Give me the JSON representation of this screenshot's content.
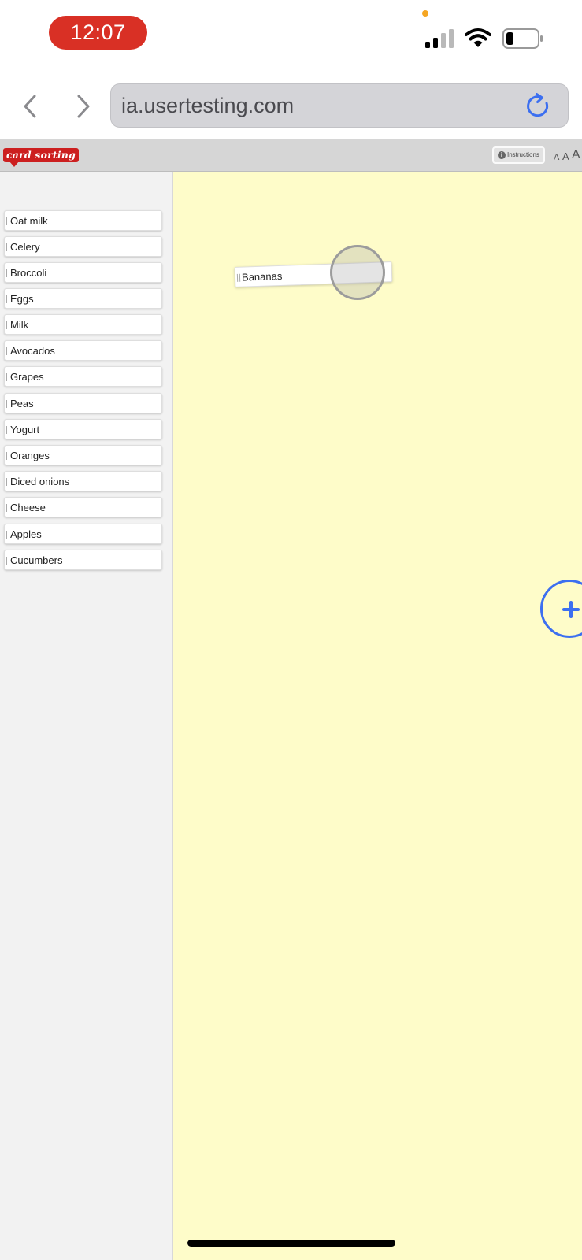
{
  "status_bar": {
    "time": "12:07"
  },
  "browser": {
    "url": "ia.usertesting.com"
  },
  "app": {
    "logo_text": "card sorting",
    "instructions_label": "Instructions",
    "font_sizes": [
      "A",
      "A",
      "A"
    ]
  },
  "sidebar": {
    "cards": [
      {
        "label": "Oat milk"
      },
      {
        "label": "Celery"
      },
      {
        "label": "Broccoli"
      },
      {
        "label": "Eggs"
      },
      {
        "label": "Milk"
      },
      {
        "label": "Avocados"
      },
      {
        "label": "Grapes"
      },
      {
        "label": "Peas"
      },
      {
        "label": "Yogurt"
      },
      {
        "label": "Oranges"
      },
      {
        "label": "Diced onions"
      },
      {
        "label": "Cheese"
      },
      {
        "label": "Apples"
      },
      {
        "label": "Cucumbers"
      }
    ]
  },
  "canvas": {
    "dragged_card": "Bananas"
  },
  "colors": {
    "time_pill": "#d93025",
    "logo": "#cc1f1f",
    "canvas_bg": "#fefcc9",
    "accent": "#3c6ff0"
  },
  "icons": [
    "back-icon",
    "forward-icon",
    "reload-icon",
    "signal-icon",
    "wifi-icon",
    "battery-icon",
    "info-icon",
    "plus-icon"
  ]
}
